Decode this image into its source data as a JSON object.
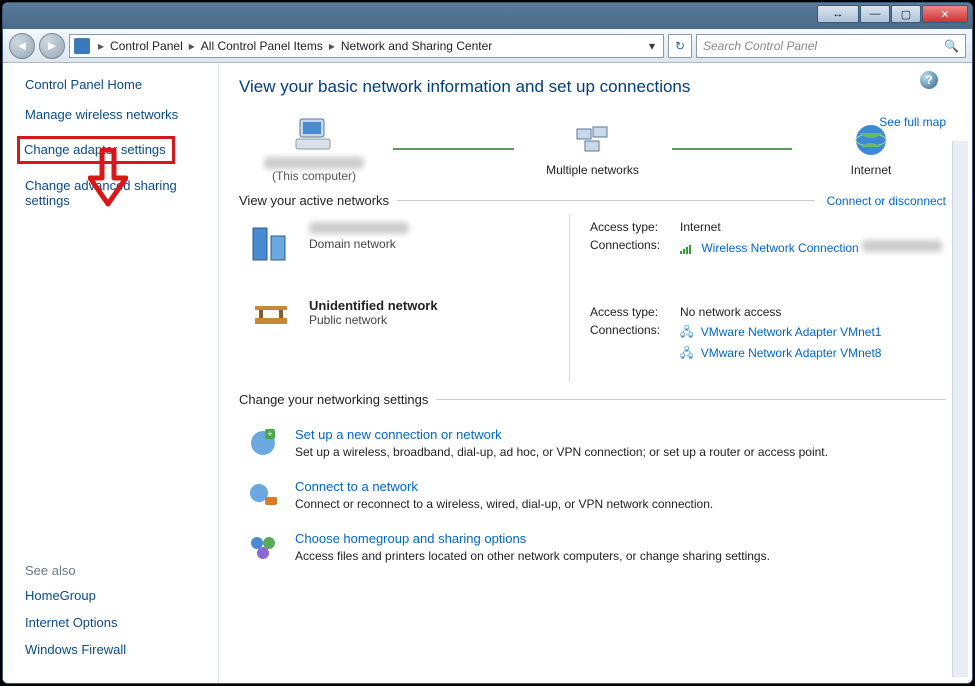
{
  "titlebar": {},
  "breadcrumb": {
    "root": "Control Panel",
    "mid": "All Control Panel Items",
    "leaf": "Network and Sharing Center"
  },
  "search": {
    "placeholder": "Search Control Panel"
  },
  "sidebar": {
    "home": "Control Panel Home",
    "items": [
      "Manage wireless networks",
      "Change adapter settings",
      "Change advanced sharing settings"
    ],
    "see_also_label": "See also",
    "see_also": [
      "HomeGroup",
      "Internet Options",
      "Windows Firewall"
    ]
  },
  "main": {
    "title": "View your basic network information and set up connections",
    "map_link": "See full map",
    "nodes": {
      "this_sub": "(This computer)",
      "multi": "Multiple networks",
      "internet": "Internet"
    },
    "active_title": "View your active networks",
    "connect_link": "Connect or disconnect",
    "net1": {
      "type": "Domain network"
    },
    "net2": {
      "name": "Unidentified network",
      "type": "Public network"
    },
    "right1": {
      "access_k": "Access type:",
      "access_v": "Internet",
      "conn_k": "Connections:",
      "conn_v": "Wireless Network Connection"
    },
    "right2": {
      "access_k": "Access type:",
      "access_v": "No network access",
      "conn_k": "Connections:",
      "conn_v1": "VMware Network Adapter VMnet1",
      "conn_v2": "VMware Network Adapter VMnet8"
    },
    "change_title": "Change your networking settings",
    "settings": [
      {
        "t": "Set up a new connection or network",
        "d": "Set up a wireless, broadband, dial-up, ad hoc, or VPN connection; or set up a router or access point."
      },
      {
        "t": "Connect to a network",
        "d": "Connect or reconnect to a wireless, wired, dial-up, or VPN network connection."
      },
      {
        "t": "Choose homegroup and sharing options",
        "d": "Access files and printers located on other network computers, or change sharing settings."
      }
    ]
  }
}
